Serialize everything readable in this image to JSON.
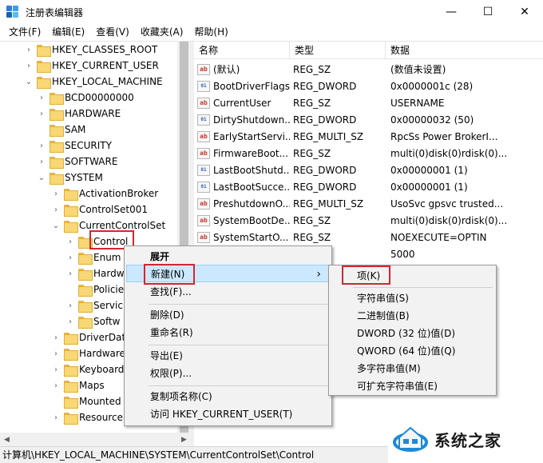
{
  "window": {
    "title": "注册表编辑器",
    "minimize": "—",
    "maximize": "☐",
    "close": "✕"
  },
  "menu": [
    "文件(F)",
    "编辑(E)",
    "查看(V)",
    "收藏夹(A)",
    "帮助(H)"
  ],
  "tree": [
    {
      "label": "HKEY_CLASSES_ROOT",
      "chev": "›"
    },
    {
      "label": "HKEY_CURRENT_USER",
      "chev": "›"
    },
    {
      "label": "HKEY_LOCAL_MACHINE",
      "chev": "⌄"
    },
    {
      "label": "BCD00000000",
      "chev": "›"
    },
    {
      "label": "HARDWARE",
      "chev": "›"
    },
    {
      "label": "SAM",
      "chev": ""
    },
    {
      "label": "SECURITY",
      "chev": "›"
    },
    {
      "label": "SOFTWARE",
      "chev": "›"
    },
    {
      "label": "SYSTEM",
      "chev": "⌄"
    },
    {
      "label": "ActivationBroker",
      "chev": "›"
    },
    {
      "label": "ControlSet001",
      "chev": "›"
    },
    {
      "label": "CurrentControlSet",
      "chev": "⌄"
    },
    {
      "label": "Control",
      "chev": "›"
    },
    {
      "label": "Enum",
      "chev": "›"
    },
    {
      "label": "Hardw",
      "chev": "›"
    },
    {
      "label": "Policie",
      "chev": ""
    },
    {
      "label": "Servic",
      "chev": "›"
    },
    {
      "label": "Softw",
      "chev": "›"
    },
    {
      "label": "DriverDat",
      "chev": "›"
    },
    {
      "label": "Hardware",
      "chev": "›"
    },
    {
      "label": "Keyboard",
      "chev": "›"
    },
    {
      "label": "Maps",
      "chev": "›"
    },
    {
      "label": "Mounted",
      "chev": ""
    },
    {
      "label": "Resource",
      "chev": "›"
    }
  ],
  "columns": [
    "名称",
    "类型",
    "数据"
  ],
  "values": [
    {
      "name": "(默认)",
      "type": "REG_SZ",
      "data": "(数值未设置)",
      "icon": "ab"
    },
    {
      "name": "BootDriverFlags",
      "type": "REG_DWORD",
      "data": "0x0000001c (28)",
      "icon": "01"
    },
    {
      "name": "CurrentUser",
      "type": "REG_SZ",
      "data": "USERNAME",
      "icon": "ab"
    },
    {
      "name": "DirtyShutdown...",
      "type": "REG_DWORD",
      "data": "0x00000032 (50)",
      "icon": "01"
    },
    {
      "name": "EarlyStartServi...",
      "type": "REG_MULTI_SZ",
      "data": "RpcSs Power BrokerI...",
      "icon": "ab"
    },
    {
      "name": "FirmwareBoot...",
      "type": "REG_SZ",
      "data": "multi(0)disk(0)rdisk(0)...",
      "icon": "ab"
    },
    {
      "name": "LastBootShutd...",
      "type": "REG_DWORD",
      "data": "0x00000001 (1)",
      "icon": "01"
    },
    {
      "name": "LastBootSucce...",
      "type": "REG_DWORD",
      "data": "0x00000001 (1)",
      "icon": "01"
    },
    {
      "name": "PreshutdownO...",
      "type": "REG_MULTI_SZ",
      "data": "UsoSvc gpsvc trusted...",
      "icon": "ab"
    },
    {
      "name": "SystemBootDe...",
      "type": "REG_SZ",
      "data": "multi(0)disk(0)rdisk(0)...",
      "icon": "ab"
    },
    {
      "name": "SystemStartO...",
      "type": "REG_SZ",
      "data": " NOEXECUTE=OPTIN",
      "icon": "ab"
    },
    {
      "name": "",
      "type": "",
      "data": "5000",
      "icon": ""
    }
  ],
  "context_menu": {
    "items": [
      "展开",
      "新建(N)",
      "查找(F)...",
      "删除(D)",
      "重命名(R)",
      "导出(E)",
      "权限(P)...",
      "复制项名称(C)",
      "访问 HKEY_CURRENT_USER(T)"
    ],
    "submenu_arrow": "›"
  },
  "submenu": [
    "项(K)",
    "字符串值(S)",
    "二进制值(B)",
    "DWORD (32 位)值(D)",
    "QWORD (64 位)值(Q)",
    "多字符串值(M)",
    "可扩充字符串值(E)"
  ],
  "status": "计算机\\HKEY_LOCAL_MACHINE\\SYSTEM\\CurrentControlSet\\Control",
  "watermark": {
    "text": "系统之家"
  },
  "colors": {
    "folder": "#f8d775",
    "highlight": "#cce8ff",
    "annotation": "#d3262f"
  }
}
